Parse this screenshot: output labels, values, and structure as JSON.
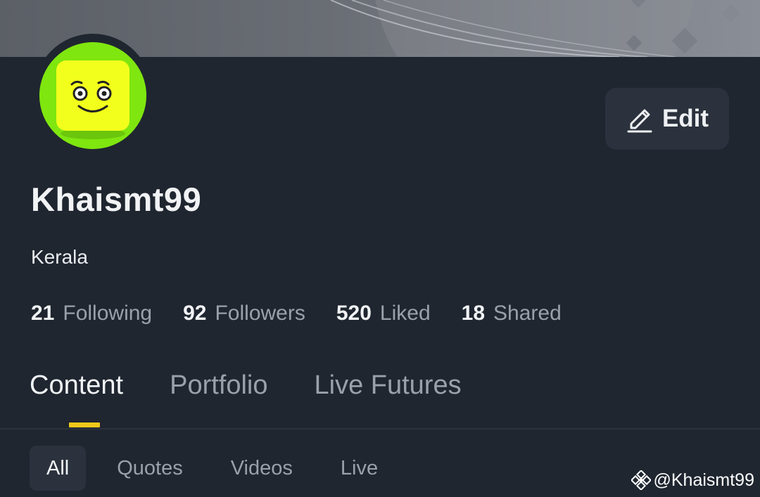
{
  "profile": {
    "username": "Khaismt99",
    "location": "Kerala",
    "edit_label": "Edit"
  },
  "stats": [
    {
      "value": "21",
      "label": "Following"
    },
    {
      "value": "92",
      "label": "Followers"
    },
    {
      "value": "520",
      "label": "Liked"
    },
    {
      "value": "18",
      "label": "Shared"
    }
  ],
  "tabs": [
    {
      "label": "Content",
      "active": true
    },
    {
      "label": "Portfolio",
      "active": false
    },
    {
      "label": "Live Futures",
      "active": false
    }
  ],
  "filters": [
    {
      "label": "All",
      "active": true
    },
    {
      "label": "Quotes",
      "active": false
    },
    {
      "label": "Videos",
      "active": false
    },
    {
      "label": "Live",
      "active": false
    }
  ],
  "watermark": {
    "text": "@Khaismt99"
  },
  "colors": {
    "background": "#1f2630",
    "accent": "#f0c91a",
    "avatar_bg": "#7fe60f",
    "avatar_face": "#f2ff1c",
    "button_bg": "#2b323d"
  }
}
